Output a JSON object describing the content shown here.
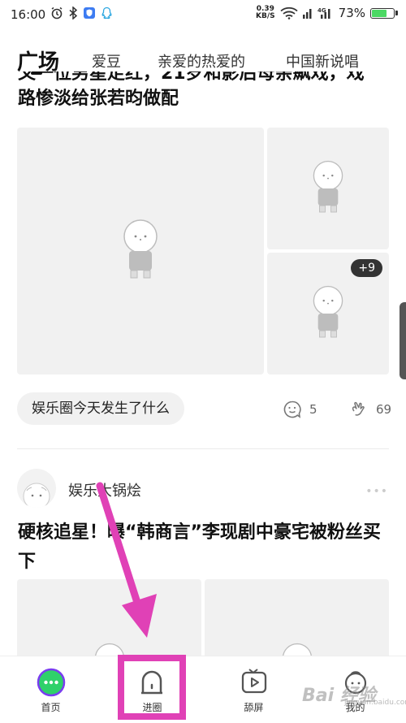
{
  "status_bar": {
    "time": "16:00",
    "speed_value": "0.39",
    "speed_unit": "KB/S",
    "network": "4G",
    "battery": "73%",
    "battery_level": 0.73
  },
  "tabs": [
    {
      "label": "广场",
      "active": true
    },
    {
      "label": "爱豆",
      "active": false
    },
    {
      "label": "亲爱的热爱的",
      "active": false
    },
    {
      "label": "中国新说唱",
      "active": false
    }
  ],
  "post1": {
    "title_line1": "又一位男星走红，21岁和影后母亲飙戏，戏",
    "title_line2": "路惨淡给张若昀做配",
    "more_count": "+9",
    "circle_tag": "娱乐圈今天发生了什么",
    "comments": "5",
    "likes": "69"
  },
  "post2": {
    "author": "娱乐大锅烩",
    "title": "硬核追星！曝“韩商言”李现剧中豪宅被粉丝买下"
  },
  "bottom_nav": [
    {
      "label": "首页",
      "icon": "home-chat-icon"
    },
    {
      "label": "进圈",
      "icon": "arch-door-icon"
    },
    {
      "label": "舔屏",
      "icon": "video-play-icon"
    },
    {
      "label": "我的",
      "icon": "profile-avatar-icon"
    }
  ],
  "watermark": {
    "text": "Bai 经验",
    "sub": "jingyan.baidu.com"
  },
  "colors": {
    "annotation": "#e041b6",
    "home_icon": "#2fd16a",
    "accent_ring": "#7a3cf0"
  }
}
